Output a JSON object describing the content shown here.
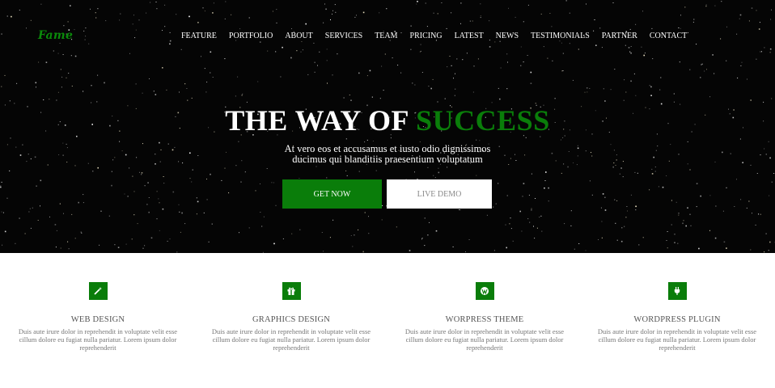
{
  "brand": {
    "logo_text": "Fame",
    "accent_color": "#0a7d0a"
  },
  "nav": {
    "items": [
      {
        "label": "FEATURE",
        "id": "feature"
      },
      {
        "label": "PORTFOLIO",
        "id": "portfolio"
      },
      {
        "label": "ABOUT",
        "id": "about"
      },
      {
        "label": "SERVICES",
        "id": "services"
      },
      {
        "label": "TEAM",
        "id": "team"
      },
      {
        "label": "PRICING",
        "id": "pricing"
      },
      {
        "label": "LATEST",
        "id": "latest"
      },
      {
        "label": "NEWS",
        "id": "news"
      },
      {
        "label": "TESTIMONIALS",
        "id": "testimonials"
      },
      {
        "label": "PARTNER",
        "id": "partner"
      },
      {
        "label": "CONTACT",
        "id": "contact"
      }
    ]
  },
  "hero": {
    "headline_prefix": "THE WAY OF",
    "headline_accent": "SUCCESS",
    "subtext_line1": "At vero eos et accusamus et iusto odio dignissimos",
    "subtext_line2": "ducimus qui blanditiis praesentium voluptatum",
    "get_now_label": "GET NOW",
    "live_demo_label": "LIVE DEMO",
    "background_color": "#050505"
  },
  "features": [
    {
      "icon": "magic-wand-icon",
      "title": "WEB DESIGN",
      "text": "Duis aute irure dolor in reprehendit in voluptate velit esse cillum dolore eu fugiat nulla pariatur. Lorem ipsum dolor reprehenderit"
    },
    {
      "icon": "gift-icon",
      "title": "GRAPHICS DESIGN",
      "text": "Duis aute irure dolor in reprehendit in voluptate velit esse cillum dolore eu fugiat nulla pariatur. Lorem ipsum dolor reprehenderit"
    },
    {
      "icon": "wordpress-icon",
      "title": "WORPRESS THEME",
      "text": "Duis aute irure dolor in reprehendit in voluptate velit esse cillum dolore eu fugiat nulla pariatur. Lorem ipsum dolor reprehenderit"
    },
    {
      "icon": "plug-icon",
      "title": "WORDPRESS PLUGIN",
      "text": "Duis aute irure dolor in reprehendit in voluptate velit esse cillum dolore eu fugiat nulla pariatur. Lorem ipsum dolor reprehenderit"
    }
  ]
}
